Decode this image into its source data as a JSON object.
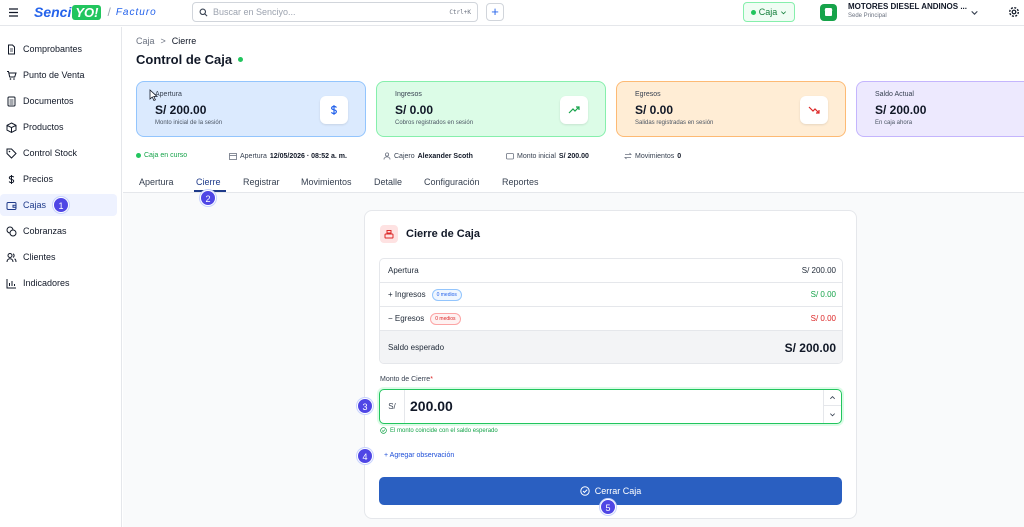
{
  "topbar": {
    "logo_main": "Senci",
    "logo_yo": "YO!",
    "logo_sep": "/",
    "logo_product": "Facturo",
    "search_placeholder": "Buscar en Senciyo...",
    "search_shortcut": "Ctrl+K",
    "add_label": "+",
    "caja_label": "Caja",
    "company_name": "MOTORES DIESEL ANDINOS ...",
    "company_branch": "Sede Principal"
  },
  "sidebar": {
    "items": [
      {
        "label": "Comprobantes",
        "icon": "document-icon"
      },
      {
        "label": "Punto de Venta",
        "icon": "cart-icon"
      },
      {
        "label": "Documentos",
        "icon": "file-list-icon"
      },
      {
        "label": "Productos",
        "icon": "box-icon"
      },
      {
        "label": "Control Stock",
        "icon": "tag-icon"
      },
      {
        "label": "Precios",
        "icon": "dollar-icon"
      },
      {
        "label": "Cajas",
        "icon": "wallet-icon",
        "active": true
      },
      {
        "label": "Cobranzas",
        "icon": "coins-icon"
      },
      {
        "label": "Clientes",
        "icon": "users-icon"
      },
      {
        "label": "Indicadores",
        "icon": "bar-chart-icon"
      }
    ]
  },
  "breadcrumb": {
    "parent": "Caja",
    "sep": ">",
    "current": "Cierre"
  },
  "page_title": "Control de Caja",
  "stats": [
    {
      "label": "Apertura",
      "value": "S/ 200.00",
      "sub": "Monto inicial de la sesión",
      "icon": "dollar-icon"
    },
    {
      "label": "Ingresos",
      "value": "S/ 0.00",
      "sub": "Cobros registrados en sesión",
      "icon": "trending-up-icon"
    },
    {
      "label": "Egresos",
      "value": "S/ 0.00",
      "sub": "Salidas registradas en sesión",
      "icon": "trending-down-icon"
    },
    {
      "label": "Saldo Actual",
      "value": "S/ 200.00",
      "sub": "En caja ahora",
      "icon": "wallet-icon"
    }
  ],
  "info": {
    "status": "Caja en curso",
    "apertura_label": "Apertura",
    "apertura_value": "12/05/2026 · 08:52 a. m.",
    "cajero_label": "Cajero",
    "cajero_value": "Alexander Scoth",
    "monto_label": "Monto inicial",
    "monto_value": "S/ 200.00",
    "mov_label": "Movimientos",
    "mov_value": "0"
  },
  "tabs": [
    "Apertura",
    "Cierre",
    "Registrar",
    "Movimientos",
    "Detalle",
    "Configuración",
    "Reportes"
  ],
  "active_tab": "Cierre",
  "cierre": {
    "title": "Cierre de Caja",
    "rows": [
      {
        "label": "Apertura",
        "value": "S/ 200.00"
      },
      {
        "label": "+ Ingresos",
        "badge": "0 medios",
        "value": "S/ 0.00"
      },
      {
        "label": "− Egresos",
        "badge": "0 medios",
        "value": "S/ 0.00"
      }
    ],
    "expected_label": "Saldo esperado",
    "expected_value": "S/ 200.00",
    "amount_label": "Monto de Cierre",
    "amount_required": "*",
    "currency": "S/",
    "amount_value": "200.00",
    "match_msg": "El monto coincide con el saldo esperado",
    "add_note": "+ Agregar observación",
    "close_button": "Cerrar Caja"
  },
  "step_badges": [
    "1",
    "2",
    "3",
    "4",
    "5"
  ],
  "colors": {
    "primary": "#2a5fc1",
    "green": "#22c55e",
    "red": "#dc2626",
    "badge": "#4f46e5"
  }
}
